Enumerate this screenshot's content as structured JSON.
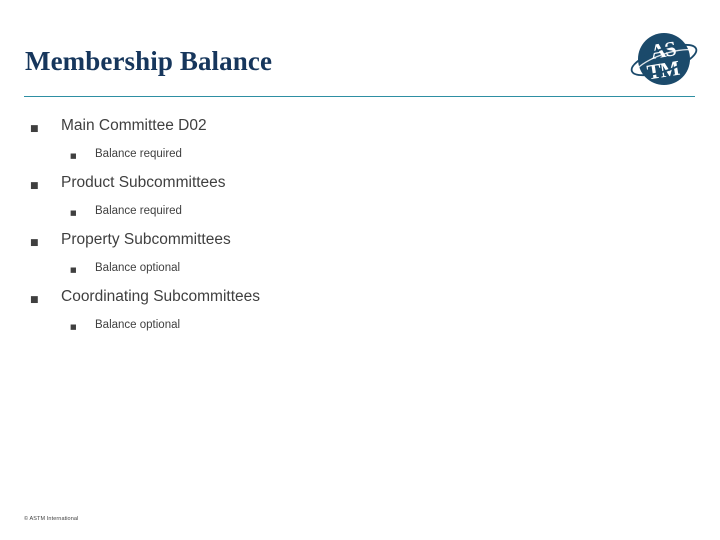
{
  "slide": {
    "title": "Membership Balance",
    "accent_color": "#2e8fa3",
    "title_color": "#16365c",
    "body_color": "#3f3f3f",
    "background_color": "#ffffff"
  },
  "logo": {
    "name": "astm-logo",
    "alt_text": "ASTM",
    "letters_top": "AS",
    "letters_bottom": "TM",
    "color": "#1b4a6b"
  },
  "bullets": [
    {
      "level": 1,
      "marker": "§",
      "text": "Main Committee D02"
    },
    {
      "level": 2,
      "marker": "§",
      "text": "Balance required"
    },
    {
      "level": 1,
      "marker": "§",
      "text": "Product Subcommittees"
    },
    {
      "level": 2,
      "marker": "§",
      "text": "Balance required"
    },
    {
      "level": 1,
      "marker": "§",
      "text": "Property Subcommittees"
    },
    {
      "level": 2,
      "marker": "§",
      "text": "Balance optional"
    },
    {
      "level": 1,
      "marker": "§",
      "text": "Coordinating Subcommittees"
    },
    {
      "level": 2,
      "marker": "§",
      "text": "Balance optional"
    }
  ],
  "footer": {
    "copyright": "© ASTM International"
  }
}
